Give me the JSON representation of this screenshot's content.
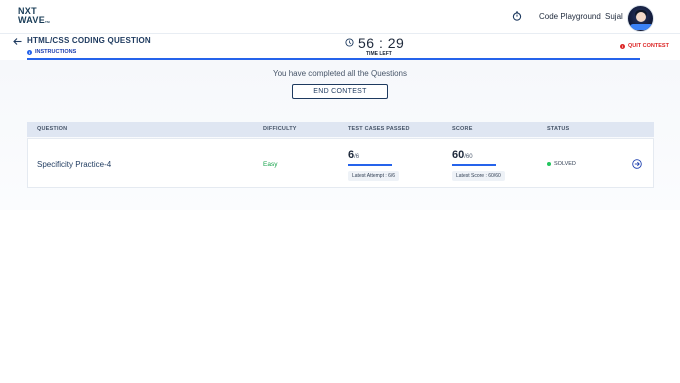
{
  "brand": {
    "line1": "NXT",
    "line2": "WAVE",
    "tm": "TM"
  },
  "nav": {
    "code_playground": "Code Playground",
    "user": "Sujal"
  },
  "header": {
    "title": "HTML/CSS CODING QUESTION",
    "instructions": "INSTRUCTIONS",
    "timer": "56 : 29",
    "timer_label": "TIME LEFT",
    "quit": "QUIT CONTEST"
  },
  "main": {
    "message": "You have completed all the Questions",
    "end_button": "END CONTEST"
  },
  "table": {
    "headers": [
      "QUESTION",
      "DIFFICULTY",
      "TEST CASES PASSED",
      "SCORE",
      "STATUS"
    ],
    "rows": [
      {
        "question": "Specificity Practice-4",
        "difficulty": "Easy",
        "passed": "6",
        "passed_total": "/6",
        "latest_attempt": "Latest Attempt : 6/6",
        "score": "60",
        "score_total": "/60",
        "latest_score": "Latest Score : 60/60",
        "status": "SOLVED"
      }
    ]
  },
  "colors": {
    "accent": "#2563eb",
    "easy": "#16a34a",
    "quit": "#dc2626",
    "solved": "#22c55e"
  }
}
